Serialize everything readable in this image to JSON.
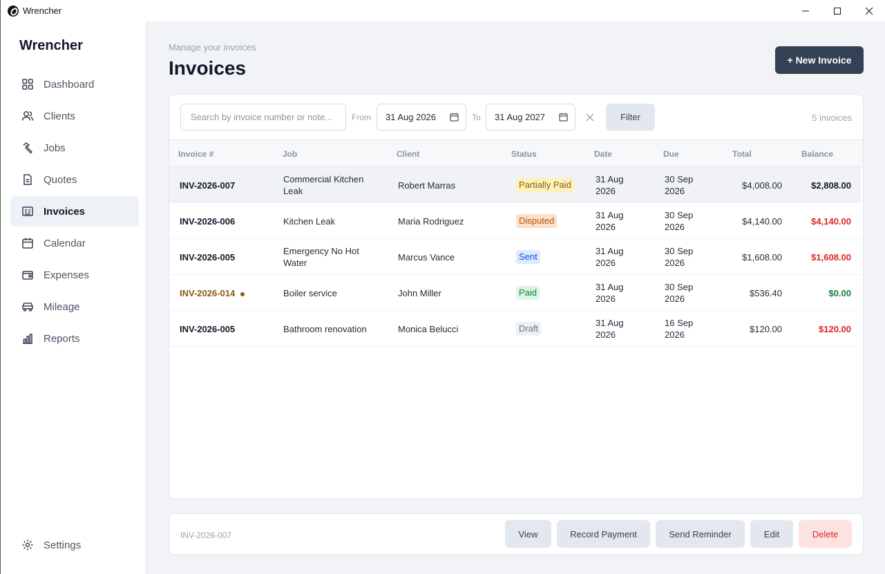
{
  "window": {
    "title": "Wrencher"
  },
  "sidebar": {
    "brand": "Wrencher",
    "items": [
      {
        "label": "Dashboard",
        "icon": "dashboard-icon"
      },
      {
        "label": "Clients",
        "icon": "users-icon"
      },
      {
        "label": "Jobs",
        "icon": "hammer-icon"
      },
      {
        "label": "Quotes",
        "icon": "document-icon"
      },
      {
        "label": "Invoices",
        "icon": "invoice-icon",
        "active": true
      },
      {
        "label": "Calendar",
        "icon": "calendar-icon"
      },
      {
        "label": "Expenses",
        "icon": "wallet-icon"
      },
      {
        "label": "Mileage",
        "icon": "car-icon"
      },
      {
        "label": "Reports",
        "icon": "bar-chart-icon"
      }
    ],
    "settings": "Settings"
  },
  "header": {
    "subtitle": "Manage your invoices",
    "title": "Invoices",
    "new_button": "+ New Invoice"
  },
  "filters": {
    "search_placeholder": "Search by invoice number or note...",
    "from_label": "From",
    "from_date": "31 Aug 2026",
    "to_label": "To",
    "to_date": "31 Aug 2027",
    "filter_button": "Filter",
    "count": "5 invoices"
  },
  "table": {
    "columns": [
      "Invoice #",
      "Job",
      "Client",
      "Status",
      "Date",
      "Due",
      "Total",
      "Balance"
    ],
    "rows": [
      {
        "invoice": "INV-2026-007",
        "job": [
          "Commercial Kitchen",
          "Leak"
        ],
        "client": "Robert Marras",
        "status": "Partially Paid",
        "date": [
          "31 Aug",
          "2026"
        ],
        "due": [
          "30 Sep",
          "2026"
        ],
        "total": "$4,008.00",
        "balance": "$2,808.00"
      },
      {
        "invoice": "INV-2026-006",
        "job": [
          "Kitchen Leak"
        ],
        "client": "Maria Rodriguez",
        "status": "Disputed",
        "date": [
          "31 Aug",
          "2026"
        ],
        "due": [
          "30 Sep",
          "2026"
        ],
        "total": "$4,140.00",
        "balance": "$4,140.00"
      },
      {
        "invoice": "INV-2026-005",
        "job": [
          "Emergency No Hot",
          "Water"
        ],
        "client": "Marcus Vance",
        "status": "Sent",
        "date": [
          "31 Aug",
          "2026"
        ],
        "due": [
          "30 Sep",
          "2026"
        ],
        "total": "$1,608.00",
        "balance": "$1,608.00"
      },
      {
        "invoice": "INV-2026-014",
        "job": [
          "Boiler service"
        ],
        "client": "John Miller",
        "status": "Paid",
        "date": [
          "31 Aug",
          "2026"
        ],
        "due": [
          "30 Sep",
          "2026"
        ],
        "total": "$536.40",
        "balance": "$0.00"
      },
      {
        "invoice": "INV-2026-005",
        "job": [
          "Bathroom renovation"
        ],
        "client": "Monica Belucci",
        "status": "Draft",
        "date": [
          "31 Aug",
          "2026"
        ],
        "due": [
          "16 Sep",
          "2026"
        ],
        "total": "$120.00",
        "balance": "$120.00"
      }
    ]
  },
  "status_colors": {
    "Partially Paid": {
      "bg": "#fdf2b8",
      "fg": "#8a5a14"
    },
    "Disputed": {
      "bg": "#fde0c8",
      "fg": "#b45309"
    },
    "Sent": {
      "bg": "#dbeafe",
      "fg": "#1d4ed8"
    },
    "Paid": {
      "bg": "#dcf5e3",
      "fg": "#15803d"
    },
    "Draft": {
      "bg": "#eef0f3",
      "fg": "#64748b"
    }
  },
  "balance_colors": {
    "dark": "#111827",
    "red": "#dc2626",
    "green": "#15803d"
  },
  "footer": {
    "selected": "INV-2026-007",
    "view": "View",
    "record_payment": "Record Payment",
    "send_reminder": "Send Reminder",
    "edit": "Edit",
    "delete": "Delete"
  }
}
